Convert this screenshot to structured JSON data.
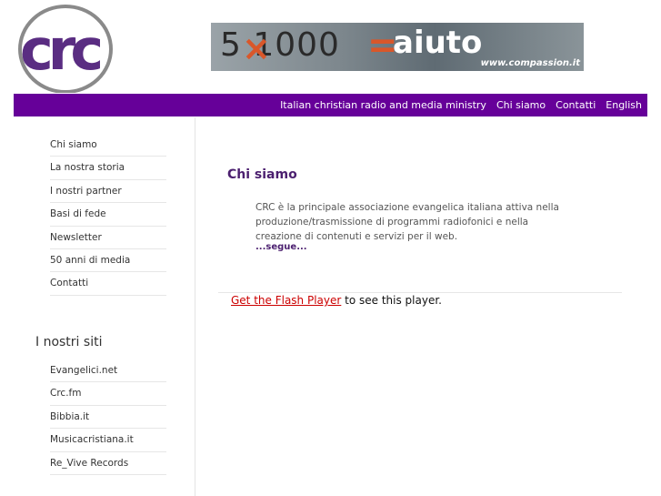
{
  "logo": {
    "text": "crc",
    "color": "#5a2d82"
  },
  "banner": {
    "number": "5 1000",
    "multiply": "×",
    "equals": "=",
    "word": "aiuto",
    "url": "www.compassion.it"
  },
  "topnav": {
    "items": [
      "Italian christian radio and media ministry",
      "Chi siamo",
      "Contatti",
      "English"
    ],
    "bg_color": "#660099"
  },
  "sidebar": {
    "menu": [
      "Chi siamo",
      "La nostra storia",
      "I nostri partner",
      "Basi di fede",
      "Newsletter",
      "50 anni di media",
      "Contatti"
    ],
    "sites_title": "I nostri siti",
    "sites": [
      "Evangelici.net",
      "Crc.fm",
      "Bibbia.it",
      "Musicacristiana.it",
      "Re_Vive Records"
    ]
  },
  "content": {
    "title": "Chi siamo",
    "text": "CRC è la principale associazione evangelica italiana attiva nella produzione/trasmissione di programmi radiofonici e nella creazione di contenuti e servizi per il web.",
    "more": "...segue..."
  },
  "flash": {
    "link": "Get the Flash Player",
    "rest": " to see this player."
  }
}
